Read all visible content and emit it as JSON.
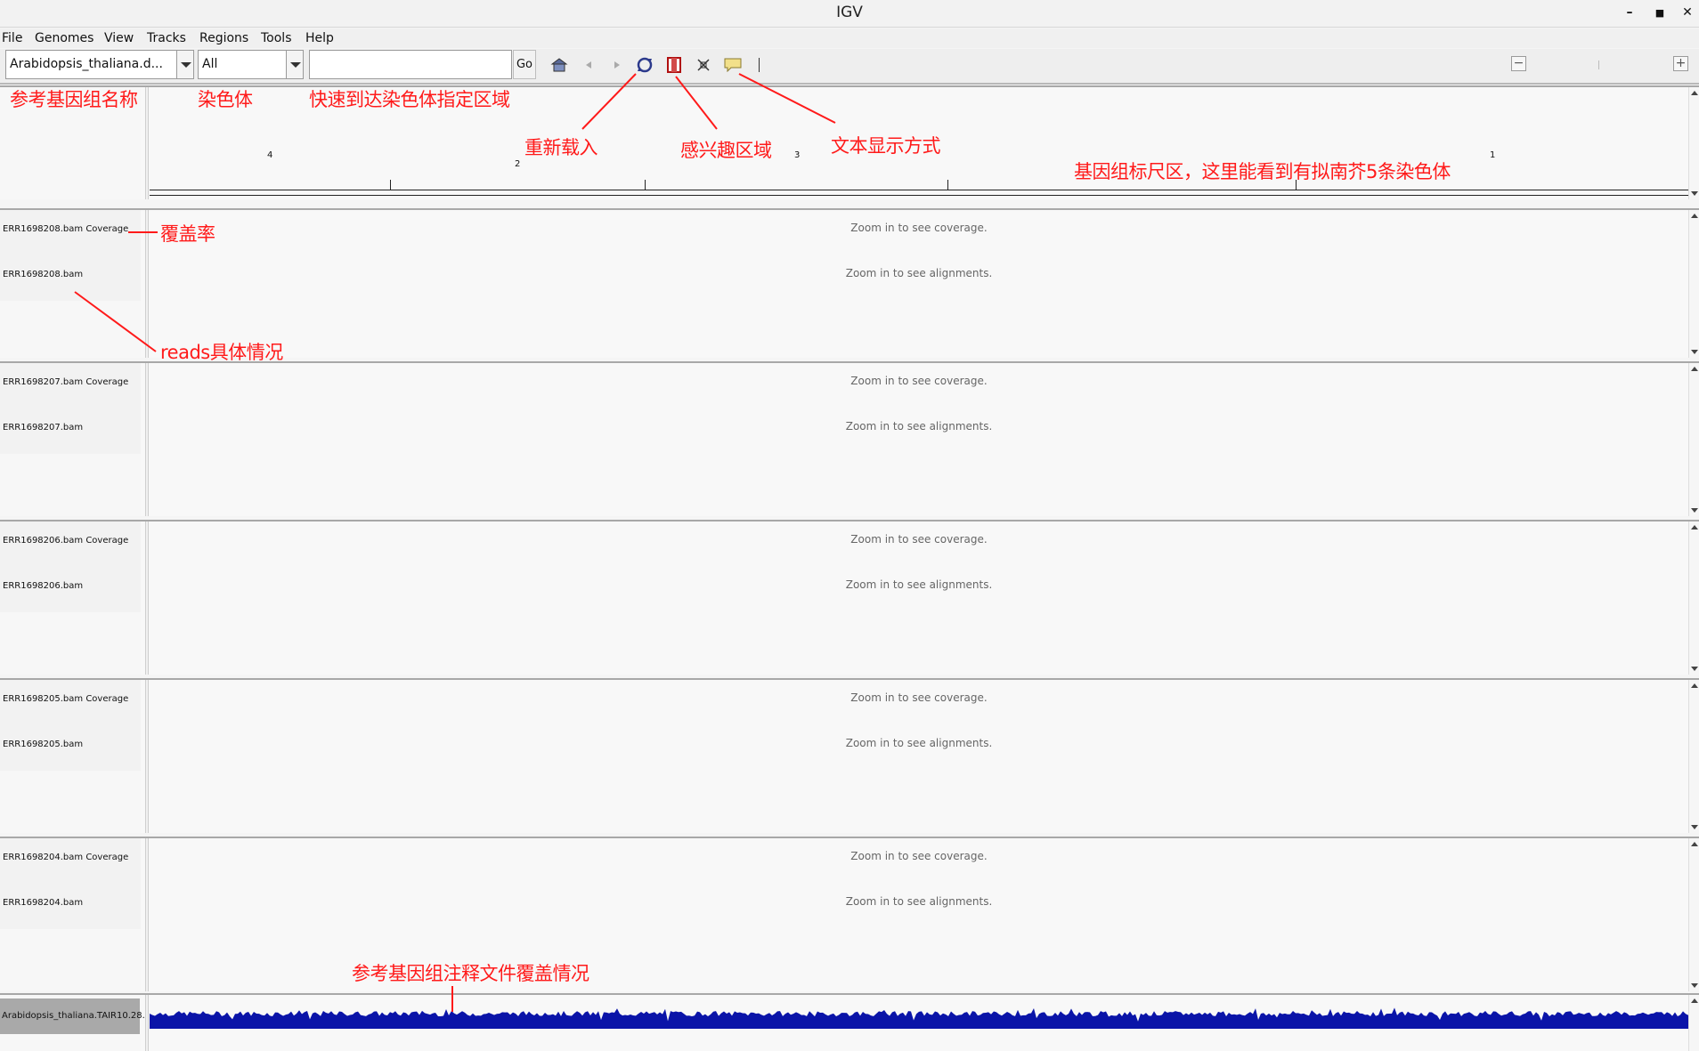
{
  "window": {
    "title": "IGV"
  },
  "menu": [
    "File",
    "Genomes",
    "View",
    "Tracks",
    "Regions",
    "Tools",
    "Help"
  ],
  "toolbar": {
    "genome_value": "Arabidopsis_thaliana.d...",
    "chromosome_value": "All",
    "locus_value": "",
    "go_label": "Go"
  },
  "ruler": {
    "chromosome_labels": [
      "4",
      "2",
      "3",
      "1"
    ]
  },
  "tracks": [
    {
      "coverage_name": "ERR1698208.bam Coverage",
      "alignment_name": "ERR1698208.bam",
      "coverage_msg": "Zoom in to see coverage.",
      "alignment_msg": "Zoom in to see alignments."
    },
    {
      "coverage_name": "ERR1698207.bam Coverage",
      "alignment_name": "ERR1698207.bam",
      "coverage_msg": "Zoom in to see coverage.",
      "alignment_msg": "Zoom in to see alignments."
    },
    {
      "coverage_name": "ERR1698206.bam Coverage",
      "alignment_name": "ERR1698206.bam",
      "coverage_msg": "Zoom in to see coverage.",
      "alignment_msg": "Zoom in to see alignments."
    },
    {
      "coverage_name": "ERR1698205.bam Coverage",
      "alignment_name": "ERR1698205.bam",
      "coverage_msg": "Zoom in to see coverage.",
      "alignment_msg": "Zoom in to see alignments."
    },
    {
      "coverage_name": "ERR1698204.bam Coverage",
      "alignment_name": "ERR1698204.bam",
      "coverage_msg": "Zoom in to see coverage.",
      "alignment_msg": "Zoom in to see alignments."
    }
  ],
  "annotation_track": {
    "name": "Arabidopsis_thaliana.TAIR10.28.",
    "color": "#0a14a8"
  },
  "annotations": {
    "genome_name": "参考基因组名称",
    "chromosome": "染色体",
    "quick_locus": "快速到达染色体指定区域",
    "reload": "重新载入",
    "roi": "感兴趣区域",
    "text_display": "文本显示方式",
    "ruler": "基因组标尺区，这里能看到有拟南芥5条染色体",
    "coverage": "覆盖率",
    "reads": "reads具体情况",
    "annotation_coverage": "参考基因组注释文件覆盖情况"
  },
  "colors": {
    "annotation_red": "#ff1a1a",
    "feature_blue": "#0a14a8"
  }
}
